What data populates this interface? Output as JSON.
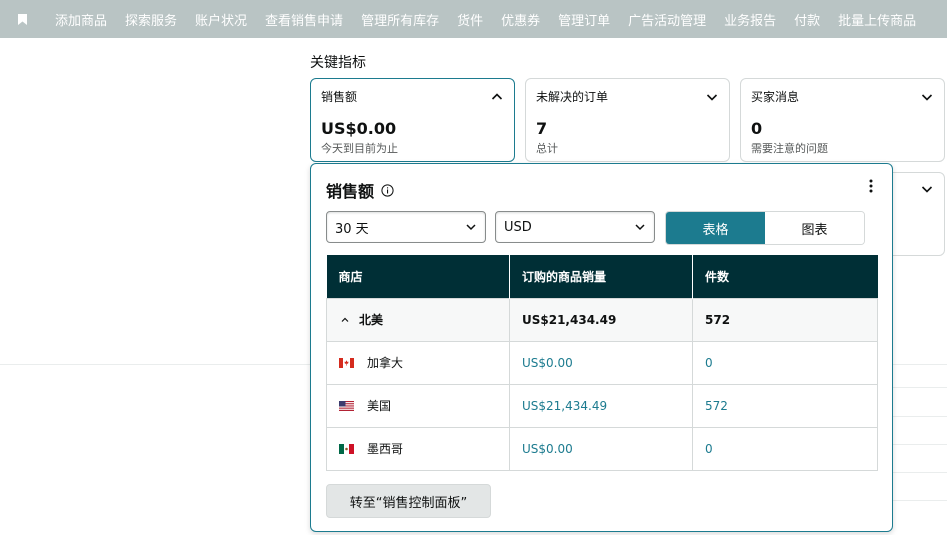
{
  "nav": {
    "items": [
      "添加商品",
      "探索服务",
      "账户状况",
      "查看销售申请",
      "管理所有库存",
      "货件",
      "优惠券",
      "管理订单",
      "广告活动管理",
      "业务报告",
      "付款",
      "批量上传商品"
    ]
  },
  "key_metrics": {
    "title": "关键指标",
    "cards": [
      {
        "label": "销售额",
        "value": "US$0.00",
        "sub": "今天到目前为止"
      },
      {
        "label": "未解决的订单",
        "value": "7",
        "sub": "总计"
      },
      {
        "label": "买家消息",
        "value": "0",
        "sub": "需要注意的问题"
      }
    ]
  },
  "popover": {
    "title": "销售额",
    "period_select": "30 天",
    "currency_select": "USD",
    "toggle": {
      "table_label": "表格",
      "chart_label": "图表"
    },
    "table": {
      "headers": [
        "商店",
        "订购的商品销量",
        "件数"
      ],
      "group": {
        "name": "北美",
        "sales": "US$21,434.49",
        "units": "572"
      },
      "rows": [
        {
          "name": "加拿大",
          "sales": "US$0.00",
          "units": "0",
          "flag": "canada-flag"
        },
        {
          "name": "美国",
          "sales": "US$21,434.49",
          "units": "572",
          "flag": "usa-flag"
        },
        {
          "name": "墨西哥",
          "sales": "US$0.00",
          "units": "0",
          "flag": "mexico-flag"
        }
      ]
    },
    "go_button": "转至“销售控制面板”"
  },
  "colors": {
    "accent": "#1c7b8f",
    "header_dark": "#002f36",
    "nav_bg": "#b9c4c4"
  }
}
